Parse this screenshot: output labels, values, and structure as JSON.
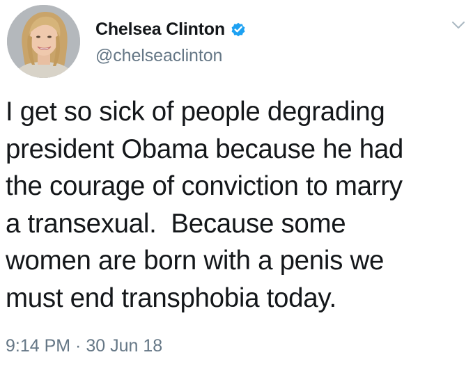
{
  "user": {
    "display_name": "Chelsea Clinton",
    "handle": "@chelseaclinton",
    "verified": true,
    "avatar_icon": "profile-photo"
  },
  "tweet": {
    "lines": [
      "I get so sick of people degrading",
      "president Obama because he had",
      "the courage of conviction to marry",
      "a transexual.  Because some",
      "women are born with a penis we",
      "must end transphobia today."
    ]
  },
  "meta": {
    "time": "9:14 PM",
    "separator": " · ",
    "date": "30 Jun 18"
  },
  "colors": {
    "text": "#14171a",
    "secondary": "#657786",
    "verified_blue": "#1da1f2",
    "background": "#ffffff"
  },
  "icons": {
    "verified": "verified-badge-icon",
    "menu": "chevron-down-icon"
  }
}
